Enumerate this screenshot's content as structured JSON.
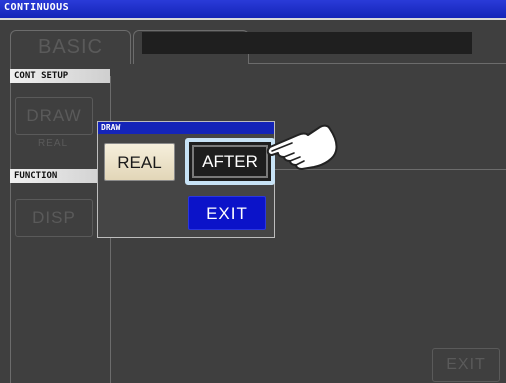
{
  "window": {
    "title": "CONTINUOUS"
  },
  "tabs": {
    "basic": "BASIC"
  },
  "sections": {
    "cont_setup": "CONT SETUP",
    "function": "FUNCTION"
  },
  "side_buttons": {
    "draw": "DRAW",
    "draw_value": "REAL",
    "disp": "DISP"
  },
  "popup": {
    "title": "DRAW",
    "real_label": "REAL",
    "after_label": "AFTER",
    "exit_label": "EXIT"
  },
  "footer": {
    "exit_label": "EXIT"
  },
  "colors": {
    "title_bar": "#1424b8",
    "exit_button": "#0b13c9",
    "real_button": "#e9dfc6",
    "after_button": "#1e1e1e",
    "highlight": "#c8e3f6"
  },
  "icons": {
    "pointer": "pointing-hand-icon"
  }
}
